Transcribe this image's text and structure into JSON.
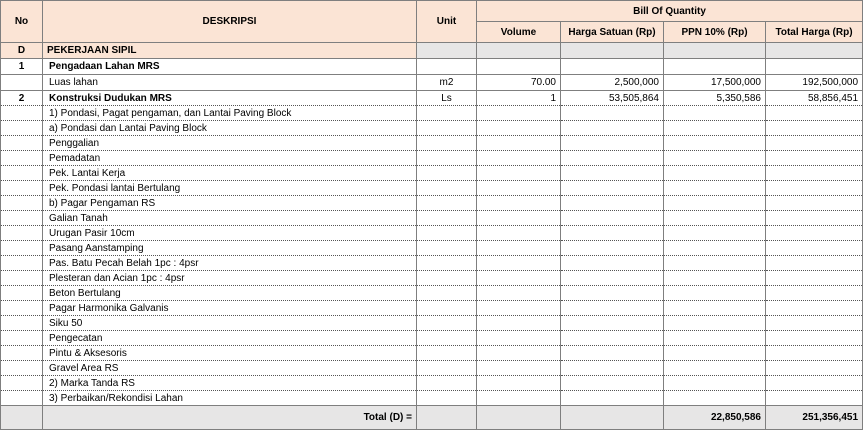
{
  "header": {
    "no": "No",
    "deskripsi": "DESKRIPSI",
    "unit": "Unit",
    "boq": "Bill Of Quantity",
    "volume": "Volume",
    "harga_satuan": "Harga Satuan (Rp)",
    "ppn": "PPN 10% (Rp)",
    "total_harga": "Total Harga (Rp)"
  },
  "section": {
    "no": "D",
    "title": "PEKERJAAN SIPIL"
  },
  "item1": {
    "no": "1",
    "title": "Pengadaan Lahan MRS",
    "sub": {
      "desc": "Luas lahan",
      "unit": "m2",
      "volume": "70.00",
      "harga": "2,500,000",
      "ppn": "17,500,000",
      "total": "192,500,000"
    }
  },
  "item2": {
    "no": "2",
    "title": "Konstruksi Dudukan MRS",
    "unit": "Ls",
    "volume": "1",
    "harga": "53,505,864",
    "ppn": "5,350,586",
    "total": "58,856,451"
  },
  "details": [
    "1) Pondasi, Pagat pengaman, dan Lantai Paving Block",
    "a) Pondasi dan Lantai Paving Block",
    "Penggalian",
    "Pemadatan",
    "Pek. Lantai Kerja",
    "Pek. Pondasi lantai Bertulang",
    "b) Pagar Pengaman RS",
    "Galian Tanah",
    "Urugan Pasir 10cm",
    "Pasang Aanstamping",
    "Pas. Batu Pecah Belah 1pc : 4psr",
    "Plesteran dan Acian 1pc : 4psr",
    "Beton Bertulang",
    "Pagar Harmonika Galvanis",
    "Siku 50",
    "Pengecatan",
    "Pintu & Aksesoris",
    "Gravel Area RS",
    "2) Marka Tanda RS",
    "3) Perbaikan/Rekondisi Lahan"
  ],
  "total": {
    "label": "Total (D) =",
    "ppn": "22,850,586",
    "total": "251,356,451"
  }
}
